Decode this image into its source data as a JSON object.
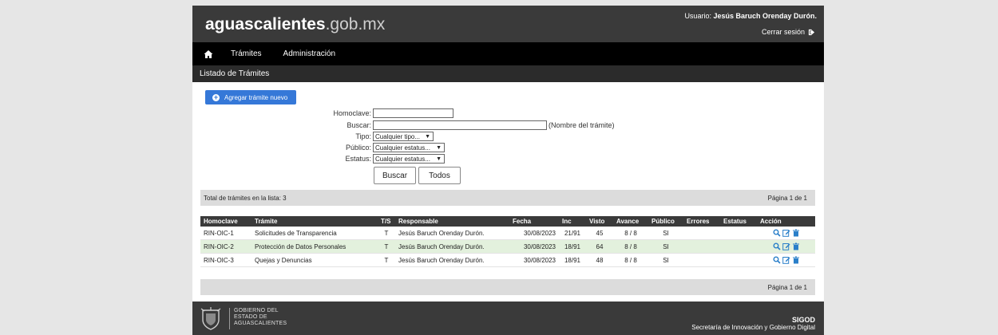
{
  "header": {
    "logo_bold": "aguascalientes",
    "logo_light": ".gob.mx",
    "user_prefix": "Usuario: ",
    "user_name": "Jesús Baruch Orenday Durón.",
    "logout_label": "Cerrar sesión"
  },
  "nav": {
    "home_icon": "home-icon",
    "items": [
      "Trámites",
      "Administración"
    ]
  },
  "subbar": {
    "title": "Listado de Trámites"
  },
  "actions": {
    "add_label": "Agregar trámite nuevo"
  },
  "filters": {
    "homoclave_label": "Homoclave:",
    "homoclave_value": "",
    "buscar_label": "Buscar:",
    "buscar_value": "",
    "buscar_hint": "(Nombre del trámite)",
    "tipo_label": "Tipo:",
    "tipo_value": "Cualquier tipo...",
    "publico_label": "Público:",
    "publico_value": "Cualquier estatus...",
    "estatus_label": "Estatus:",
    "estatus_value": "Cualquier estatus...",
    "search_button": "Buscar",
    "all_button": "Todos"
  },
  "summary": {
    "total_label": "Total de trámites en la lista: 3",
    "page_label": "Página 1 de 1"
  },
  "table": {
    "headers": [
      "Homoclave",
      "Trámite",
      "T/S",
      "Responsable",
      "Fecha",
      "Inc",
      "Visto",
      "Avance",
      "Público",
      "Errores",
      "Estatus",
      "Acción"
    ],
    "rows": [
      {
        "homoclave": "RIN-OIC-1",
        "tramite": "Solicitudes de Transparencia",
        "ts": "T",
        "responsable": "Jesús Baruch Orenday Durón.",
        "fecha": "30/08/2023",
        "inc": "21/91",
        "visto": "45",
        "avance": "8 / 8",
        "publico": "SI",
        "errores": "",
        "estatus": ""
      },
      {
        "homoclave": "RIN-OIC-2",
        "tramite": "Protección de Datos Personales",
        "ts": "T",
        "responsable": "Jesús Baruch Orenday Durón.",
        "fecha": "30/08/2023",
        "inc": "18/91",
        "visto": "64",
        "avance": "8 / 8",
        "publico": "SI",
        "errores": "",
        "estatus": ""
      },
      {
        "homoclave": "RIN-OIC-3",
        "tramite": "Quejas y Denuncias",
        "ts": "T",
        "responsable": "Jesús Baruch Orenday Durón.",
        "fecha": "30/08/2023",
        "inc": "18/91",
        "visto": "48",
        "avance": "8 / 8",
        "publico": "SI",
        "errores": "",
        "estatus": ""
      }
    ]
  },
  "footer": {
    "gov_line1": "GOBIERNO DEL",
    "gov_line2": "ESTADO DE",
    "gov_line3": "AGUASCALIENTES",
    "system": "SIGOD",
    "secretaria": "Secretaría de Innovación y Gobierno Digital"
  },
  "colors": {
    "header_bg": "#3a3a3a",
    "nav_bg": "#000000",
    "accent": "#3578d8",
    "row_highlight": "#e3f1dd"
  }
}
